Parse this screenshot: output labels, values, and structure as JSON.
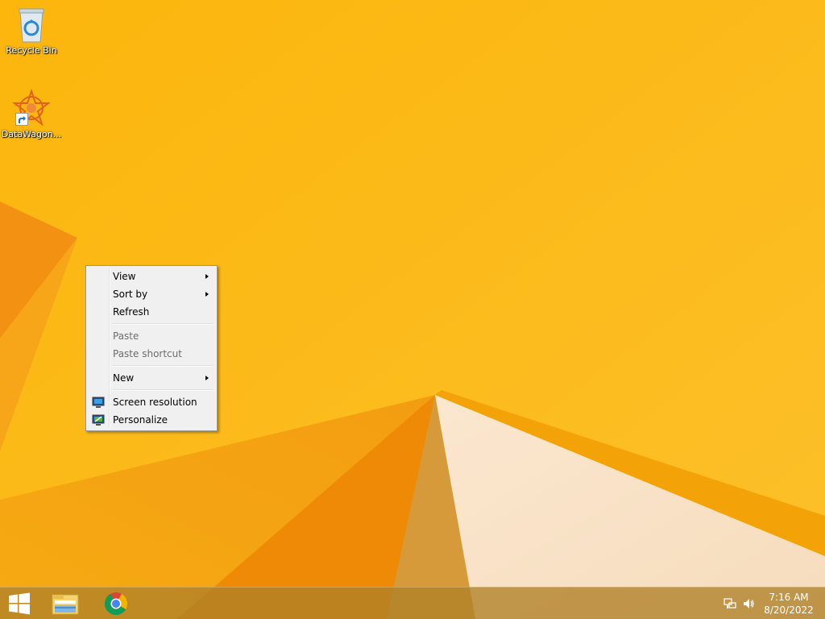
{
  "desktop": {
    "icons": [
      {
        "label": "Recycle Bin",
        "icon": "recycle-bin-icon"
      },
      {
        "label": "DataWagon...",
        "icon": "datawagon-icon"
      }
    ]
  },
  "context_menu": {
    "items": [
      {
        "label": "View",
        "submenu": true,
        "enabled": true
      },
      {
        "label": "Sort by",
        "submenu": true,
        "enabled": true
      },
      {
        "label": "Refresh",
        "submenu": false,
        "enabled": true
      },
      {
        "label": "Paste",
        "submenu": false,
        "enabled": false
      },
      {
        "label": "Paste shortcut",
        "submenu": false,
        "enabled": false
      },
      {
        "label": "New",
        "submenu": true,
        "enabled": true
      },
      {
        "label": "Screen resolution",
        "submenu": false,
        "enabled": true,
        "icon": "screen-resolution-icon"
      },
      {
        "label": "Personalize",
        "submenu": false,
        "enabled": true,
        "icon": "personalize-icon"
      }
    ]
  },
  "taskbar": {
    "pinned": [
      {
        "icon": "file-explorer-icon"
      },
      {
        "icon": "chrome-icon"
      }
    ],
    "tray": {
      "icons": [
        "network-icon",
        "volume-icon"
      ],
      "time": "7:16 AM",
      "date": "8/20/2022"
    }
  },
  "colors": {
    "wallpaper_base": "#fbb814",
    "wallpaper_dark": "#f08c00",
    "taskbar": "#b08028",
    "menu_bg": "#f0f0f0"
  }
}
